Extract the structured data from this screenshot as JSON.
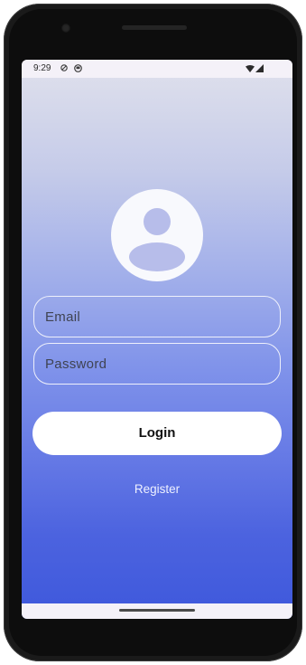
{
  "status_bar": {
    "time": "9:29"
  },
  "form": {
    "email_placeholder": "Email",
    "password_placeholder": "Password",
    "login_label": "Login",
    "register_label": "Register"
  },
  "icons": {
    "avatar": "account-circle-icon",
    "status_a": "dnd-icon",
    "status_b": "app-icon",
    "wifi": "wifi-icon",
    "signal": "cellular-signal-icon"
  },
  "colors": {
    "gradient_top": "#e0e1ec",
    "gradient_bottom": "#3e58dc",
    "button_bg": "#ffffff"
  }
}
